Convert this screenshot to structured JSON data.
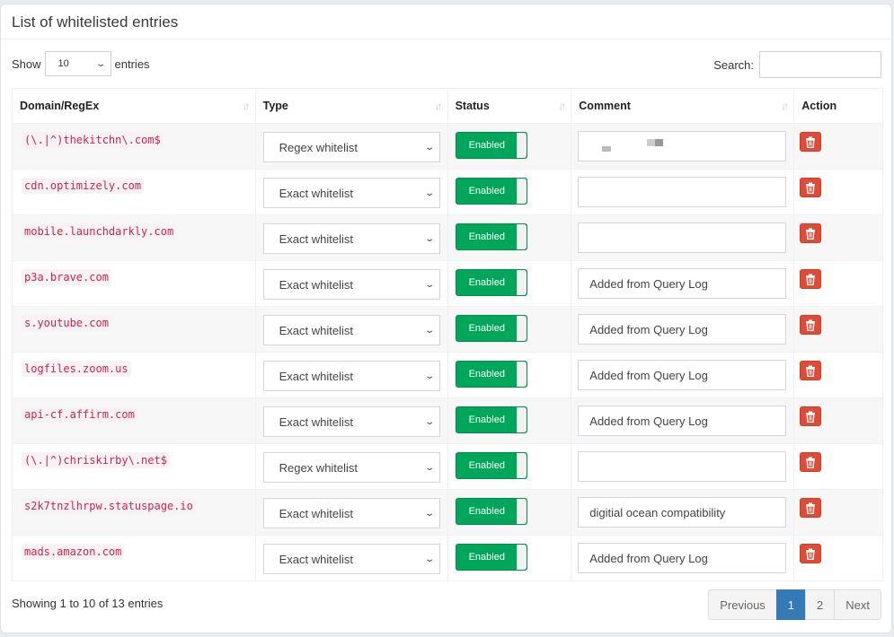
{
  "header": {
    "title": "List of whitelisted entries"
  },
  "length": {
    "show_label": "Show",
    "value": "10",
    "entries_label": "entries"
  },
  "search": {
    "label": "Search:",
    "value": ""
  },
  "columns": [
    "Domain/RegEx",
    "Type",
    "Status",
    "Comment",
    "Action"
  ],
  "rows": [
    {
      "domain": "(\\.|^)thekitchn\\.com$",
      "type": "Regex whitelist",
      "status": "Enabled",
      "comment": ""
    },
    {
      "domain": "cdn.optimizely.com",
      "type": "Exact whitelist",
      "status": "Enabled",
      "comment": ""
    },
    {
      "domain": "mobile.launchdarkly.com",
      "type": "Exact whitelist",
      "status": "Enabled",
      "comment": ""
    },
    {
      "domain": "p3a.brave.com",
      "type": "Exact whitelist",
      "status": "Enabled",
      "comment": "Added from Query Log"
    },
    {
      "domain": "s.youtube.com",
      "type": "Exact whitelist",
      "status": "Enabled",
      "comment": "Added from Query Log"
    },
    {
      "domain": "logfiles.zoom.us",
      "type": "Exact whitelist",
      "status": "Enabled",
      "comment": "Added from Query Log"
    },
    {
      "domain": "api-cf.affirm.com",
      "type": "Exact whitelist",
      "status": "Enabled",
      "comment": "Added from Query Log"
    },
    {
      "domain": "(\\.|^)chriskirby\\.net$",
      "type": "Regex whitelist",
      "status": "Enabled",
      "comment": ""
    },
    {
      "domain": "s2k7tnzlhrpw.statuspage.io",
      "type": "Exact whitelist",
      "status": "Enabled",
      "comment": "digitial ocean compatibility"
    },
    {
      "domain": "mads.amazon.com",
      "type": "Exact whitelist",
      "status": "Enabled",
      "comment": "Added from Query Log"
    }
  ],
  "footer": {
    "info": "Showing 1 to 10 of 13 entries"
  },
  "pagination": {
    "previous": "Previous",
    "pages": [
      "1",
      "2"
    ],
    "active": "1",
    "next": "Next"
  },
  "colors": {
    "enabled": "#00a65a",
    "delete": "#dd4b39",
    "page_active": "#337ab7",
    "domain_text": "#c7254e"
  }
}
